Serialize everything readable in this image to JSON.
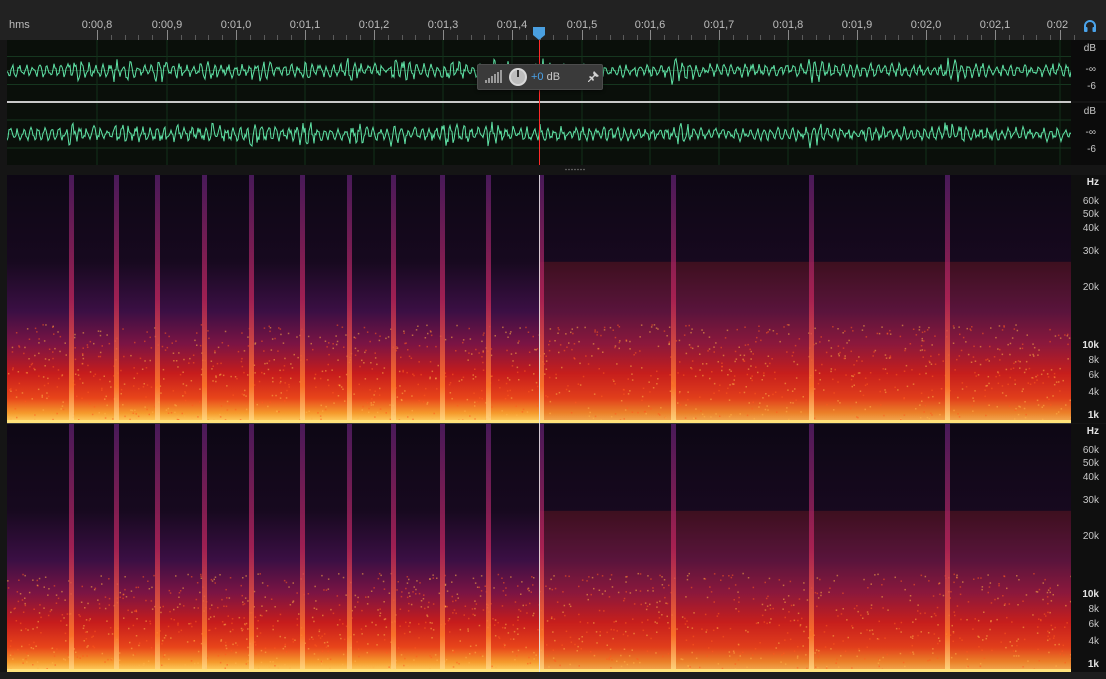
{
  "ruler": {
    "unit": "hms",
    "ticks": [
      "0:00,8",
      "0:00,9",
      "0:01,0",
      "0:01,1",
      "0:01,2",
      "0:01,3",
      "0:01,4",
      "0:01,5",
      "0:01,6",
      "0:01,7",
      "0:01,8",
      "0:01,9",
      "0:02,0",
      "0:02,1",
      "0:02"
    ]
  },
  "waveform": {
    "channels": [
      {
        "db_label": "dB",
        "inf_label": "-∞",
        "minus6_label": "-6"
      },
      {
        "db_label": "dB",
        "inf_label": "-∞",
        "minus6_label": "-6"
      }
    ],
    "color": "#5fe3a6"
  },
  "hud": {
    "gain_value": "+0",
    "gain_unit": "dB"
  },
  "spectral": {
    "channels": [
      {
        "labels": [
          "Hz",
          "60k",
          "50k",
          "40k",
          "30k",
          "20k",
          "10k",
          "8k",
          "6k",
          "4k",
          "1k"
        ]
      },
      {
        "labels": [
          "Hz",
          "60k",
          "50k",
          "40k",
          "30k",
          "20k",
          "10k",
          "8k",
          "6k",
          "4k",
          "1k"
        ]
      }
    ]
  },
  "colors": {
    "playhead_marker": "#4a9fe0",
    "playhead_line": "#ff2a2a",
    "accent": "#4aa3ea"
  }
}
